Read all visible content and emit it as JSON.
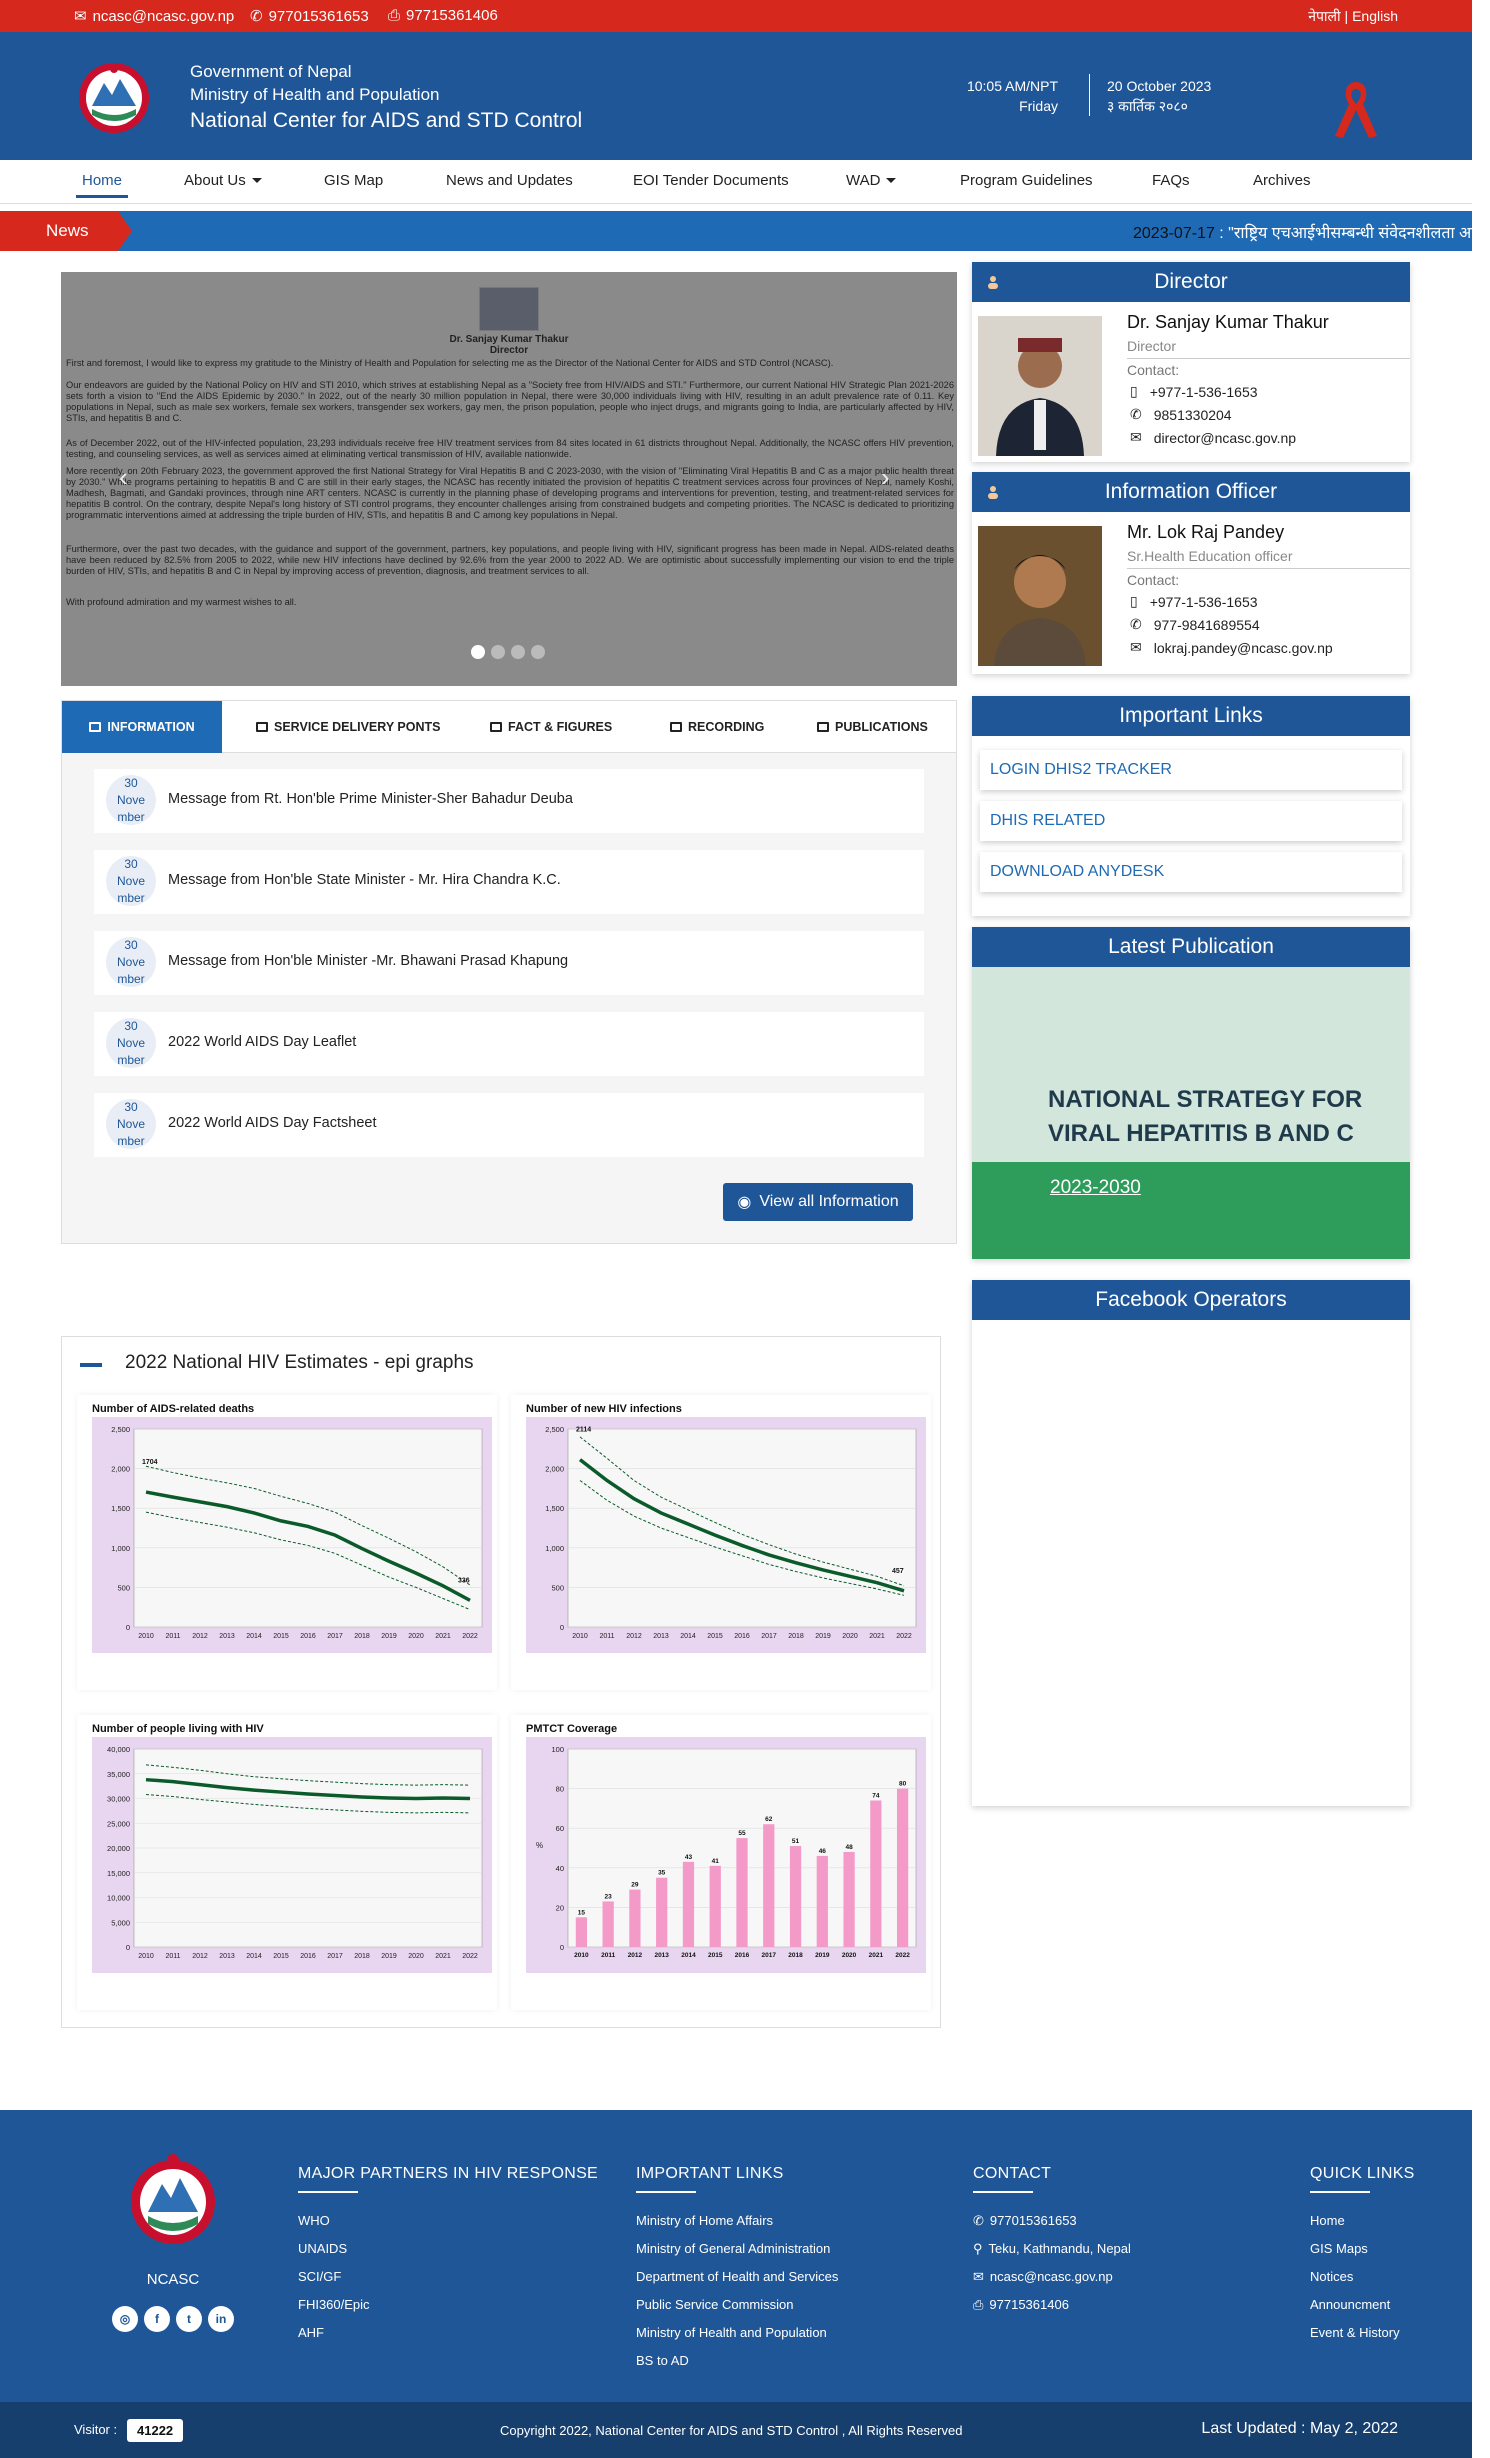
{
  "topbar": {
    "email": "ncasc@ncasc.gov.np",
    "phone": "977015361653",
    "fax": "97715361406",
    "lang_ne": "नेपाली",
    "lang_sep": " | ",
    "lang_en": "English"
  },
  "header": {
    "line1": "Government of Nepal",
    "line2": "Ministry of Health and Population",
    "line3": "National Center for AIDS and STD Control",
    "time": "10:05 AM/NPT",
    "day": "Friday",
    "date_en": "20 October 2023",
    "date_ne": "३ कार्तिक २०८०"
  },
  "nav": {
    "items": [
      "Home",
      "About Us",
      "GIS Map",
      "News and Updates",
      "EOI Tender Documents",
      "WAD",
      "Program Guidelines",
      "FAQs",
      "Archives"
    ]
  },
  "news": {
    "label": "News",
    "date": "2023-07-17",
    "text": " : \"राष्ट्रिय एचआईभीसम्बन्धी संवेदनशीलता अभियान"
  },
  "slider": {
    "name": "Dr. Sanjay Kumar Thakur",
    "role": "Director",
    "p1": "First and foremost, I would like to express my gratitude to the Ministry of Health and Population for selecting me as the Director of the National Center for AIDS and STD Control (NCASC).",
    "p2": "Our endeavors are guided by the National Policy on HIV and STI 2010, which strives at establishing Nepal as a \"Society free from HIV/AIDS and STI.\" Furthermore, our current National HIV Strategic Plan 2021-2026 sets forth a vision to \"End the AIDS Epidemic by 2030.\" In 2022, out of the nearly 30 million population in Nepal, there were 30,000 individuals living with HIV, resulting in an adult prevalence rate of 0.11. Key populations in Nepal, such as male sex workers, female sex workers, transgender sex workers, gay men, the prison population, people who inject drugs, and migrants going to India, are particularly affected by HIV, STIs, and hepatitis B and C.",
    "p3": "As of December 2022, out of the HIV-infected population, 23,293 individuals receive free HIV treatment services from 84 sites located in 61 districts throughout Nepal. Additionally, the NCASC offers HIV prevention, testing, and counseling services, as well as services aimed at eliminating vertical transmission of HIV, available nationwide.",
    "p4": "More recently, on 20th February 2023, the government approved the first National Strategy for Viral Hepatitis B and C 2023-2030, with the vision of \"Eliminating Viral Hepatitis B and C as a major public health threat by 2030.\" While programs pertaining to hepatitis B and C are still in their early stages, the NCASC has recently initiated the provision of hepatitis C treatment services across four provinces of Nepal, namely Koshi, Madhesh, Bagmati, and Gandaki provinces, through nine ART centers. NCASC is currently in the planning phase of developing programs and interventions for prevention, testing, and treatment-related services for hepatitis B control. On the contrary, despite Nepal's long history of STI control programs, they encounter challenges arising from constrained budgets and competing priorities. The NCASC is dedicated to prioritizing programmatic interventions aimed at addressing the triple burden of HIV, STIs, and hepatitis B and C among key populations in Nepal.",
    "p5": "Furthermore, over the past two decades, with the guidance and support of the government, partners, key populations, and people living with HIV, significant progress has been made in Nepal. AIDS-related deaths have been reduced by 82.5% from 2005 to 2022, while new HIV infections have declined by 92.6% from the year 2000 to 2022 AD. We are optimistic about successfully implementing our vision to end the triple burden of HIV, STIs, and hepatitis B and C in Nepal by improving access of prevention, diagnosis, and treatment services to all.",
    "p6": "With profound admiration and my warmest wishes to all."
  },
  "director": {
    "heading": "Director",
    "name": "Dr. Sanjay Kumar Thakur",
    "role": "Director",
    "contact_label": "Contact:",
    "phone": "+977-1-536-1653",
    "mobile": "9851330204",
    "email": "director@ncasc.gov.np"
  },
  "info_officer": {
    "heading": "Information Officer",
    "name": "Mr. Lok Raj Pandey",
    "role": "Sr.Health Education officer",
    "contact_label": "Contact:",
    "phone": "+977-1-536-1653",
    "mobile": "977-9841689554",
    "email": "lokraj.pandey@ncasc.gov.np"
  },
  "important_links": {
    "heading": "Important Links",
    "items": [
      "LOGIN DHIS2 TRACKER",
      "DHIS RELATED",
      "DOWNLOAD ANYDESK"
    ]
  },
  "latest_publication": {
    "heading": "Latest Publication",
    "title1": "NATIONAL STRATEGY FOR",
    "title2": "VIRAL HEPATITIS B AND C",
    "years": "2023-2030"
  },
  "facebook": {
    "heading": "Facebook Operators"
  },
  "tabs": {
    "items": [
      "INFORMATION",
      "SERVICE DELIVERY PONTS",
      "FACT & FIGURES",
      "RECORDING",
      "PUBLICATIONS"
    ],
    "list": [
      {
        "d1": "30",
        "d2": "Nove",
        "d3": "mber",
        "title": "Message from Rt. Hon'ble Prime Minister-Sher Bahadur Deuba"
      },
      {
        "d1": "30",
        "d2": "Nove",
        "d3": "mber",
        "title": "Message from Hon'ble State Minister - Mr. Hira Chandra K.C."
      },
      {
        "d1": "30",
        "d2": "Nove",
        "d3": "mber",
        "title": "Message from Hon'ble Minister -Mr. Bhawani Prasad Khapung"
      },
      {
        "d1": "30",
        "d2": "Nove",
        "d3": "mber",
        "title": "2022 World AIDS Day Leaflet"
      },
      {
        "d1": "30",
        "d2": "Nove",
        "d3": "mber",
        "title": "2022 World AIDS Day Factsheet"
      }
    ],
    "view_all": "View all Information"
  },
  "graphs": {
    "title": "2022 National HIV Estimates - epi graphs"
  },
  "chart_data": [
    {
      "type": "line",
      "title": "Number of AIDS-related deaths",
      "x": [
        2010,
        2011,
        2012,
        2013,
        2014,
        2015,
        2016,
        2017,
        2018,
        2019,
        2020,
        2021,
        2022
      ],
      "series": [
        {
          "values": [
            1704,
            1640,
            1580,
            1520,
            1440,
            1340,
            1270,
            1160,
            990,
            830,
            680,
            520,
            336
          ]
        },
        {
          "values": [
            2030,
            1950,
            1880,
            1820,
            1750,
            1650,
            1560,
            1450,
            1280,
            1120,
            950,
            760,
            530
          ]
        },
        {
          "values": [
            1450,
            1380,
            1320,
            1260,
            1190,
            1100,
            1030,
            930,
            780,
            630,
            500,
            360,
            220
          ]
        }
      ],
      "annotations": [
        "1704",
        "336"
      ],
      "ylim": [
        0,
        2500
      ],
      "yticks": [
        "0",
        "500",
        "1,000",
        "1,500",
        "2,000",
        "2,500"
      ],
      "grid": true
    },
    {
      "type": "line",
      "title": "Number of new HIV infections",
      "x": [
        2010,
        2011,
        2012,
        2013,
        2014,
        2015,
        2016,
        2017,
        2018,
        2019,
        2020,
        2021,
        2022
      ],
      "series": [
        {
          "values": [
            2114,
            1850,
            1620,
            1440,
            1300,
            1160,
            1030,
            910,
            810,
            720,
            640,
            560,
            457
          ]
        },
        {
          "values": [
            2400,
            2130,
            1850,
            1640,
            1480,
            1320,
            1170,
            1040,
            920,
            820,
            730,
            640,
            520
          ]
        },
        {
          "values": [
            1850,
            1600,
            1400,
            1250,
            1130,
            1010,
            900,
            790,
            700,
            620,
            550,
            480,
            400
          ]
        }
      ],
      "annotations": [
        "2114",
        "457"
      ],
      "ylim": [
        0,
        2500
      ],
      "yticks": [
        "0",
        "500",
        "1,000",
        "1,500",
        "2,000",
        "2,500"
      ],
      "grid": true
    },
    {
      "type": "line",
      "title": "Number of people living with HIV",
      "x": [
        2010,
        2011,
        2012,
        2013,
        2014,
        2015,
        2016,
        2017,
        2018,
        2019,
        2020,
        2021,
        2022
      ],
      "series": [
        {
          "values": [
            33800,
            33400,
            32800,
            32200,
            31700,
            31300,
            30900,
            30600,
            30300,
            30100,
            30000,
            30100,
            30000
          ]
        },
        {
          "values": [
            36800,
            36300,
            35700,
            35000,
            34400,
            34000,
            33600,
            33300,
            33000,
            32800,
            32700,
            32800,
            32700
          ]
        },
        {
          "values": [
            30800,
            30400,
            29800,
            29300,
            28800,
            28400,
            28000,
            27700,
            27400,
            27200,
            27100,
            27200,
            27100
          ]
        }
      ],
      "ylim": [
        0,
        40000
      ],
      "yticks": [
        "0",
        "5,000",
        "10,000",
        "15,000",
        "20,000",
        "25,000",
        "30,000",
        "35,000",
        "40,000"
      ],
      "grid": true
    },
    {
      "type": "bar",
      "title": "PMTCT Coverage",
      "ylabel": "%",
      "categories": [
        "2010",
        "2011",
        "2012",
        "2013",
        "2014",
        "2015",
        "2016",
        "2017",
        "2018",
        "2019",
        "2020",
        "2021",
        "2022"
      ],
      "values": [
        15,
        23,
        29,
        35,
        43,
        41,
        55,
        62,
        51,
        46,
        48,
        74,
        80
      ],
      "ylim": [
        0,
        100
      ],
      "yticks": [
        "0",
        "20",
        "40",
        "60",
        "80",
        "100"
      ],
      "grid": true,
      "colors": {
        "bar": "#f49ac8"
      }
    }
  ],
  "footer": {
    "org": "NCASC",
    "partners_head": "MAJOR PARTNERS IN HIV RESPONSE",
    "partners": [
      "WHO",
      "UNAIDS",
      "SCI/GF",
      "FHI360/Epic",
      "AHF"
    ],
    "links_head": "IMPORTANT LINKS",
    "links": [
      "Ministry of Home Affairs",
      "Ministry of General Administration",
      "Department of Health and Services",
      "Public Service Commission",
      "Ministry of Health and Population",
      "BS to AD"
    ],
    "contact_head": "CONTACT",
    "contact": [
      "977015361653",
      "Teku, Kathmandu, Nepal",
      "ncasc@ncasc.gov.np",
      "97715361406"
    ],
    "quick_head": "QUICK LINKS",
    "quick": [
      "Home",
      "GIS Maps",
      "Notices",
      "Announcment",
      "Event & History"
    ],
    "visitor_label": "Visitor :",
    "visitor_count": "41222",
    "copyright": "Copyright 2022, National Center for AIDS and STD Control , All Rights Reserved",
    "updated": "Last Updated : May 2, 2022"
  },
  "colors": {
    "primary": "#1f5697",
    "accent_red": "#d6281c",
    "news_blue": "#1f6ab4",
    "chart_bg": "#e8d5f0",
    "pmtct_bar": "#f49ac8",
    "line_green": "#0a5a2a"
  }
}
